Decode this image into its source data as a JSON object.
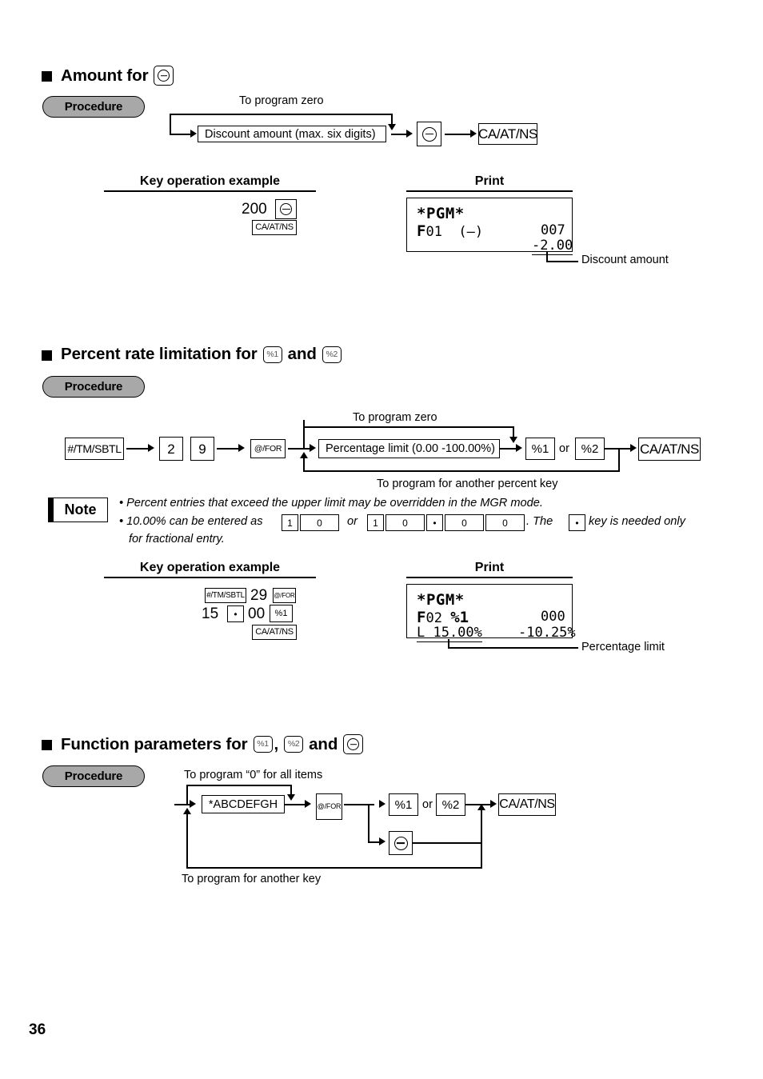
{
  "page": {
    "number": "36"
  },
  "sections": [
    {
      "id": "amount-for-minus",
      "title_prefix": "Amount for",
      "title_keys": [
        "minus"
      ],
      "procedure_label": "Procedure",
      "flow": {
        "top_label": "To program zero",
        "box_label": "Discount amount (max. six digits)",
        "keys": [
          "minus",
          "CA/AT/NS"
        ]
      },
      "columns": {
        "left": "Key operation example",
        "right": "Print"
      },
      "key_operation": {
        "line1_value": "200",
        "line1_key": "minus",
        "line2_key": "CA/AT/NS"
      },
      "print": {
        "header": "*PGM*",
        "row1_left_bold": "F",
        "row1_left_rest": "01",
        "row1_mid": "(—)",
        "row1_right": "007",
        "row2_right": "-2.00",
        "callout": "Discount amount"
      }
    },
    {
      "id": "percent-rate-limitation",
      "title_prefix": "Percent rate limitation for",
      "title_mid": "and",
      "title_keys": [
        "%1",
        "%2"
      ],
      "procedure_label": "Procedure",
      "flow": {
        "top_label": "To program zero",
        "bottom_label": "To program for another percent key",
        "box_label": "Percentage limit (0.00 -100.00%)",
        "key_sbtl": "#/TM/SBTL",
        "key_digit1": "2",
        "key_digit2": "9",
        "key_for": "@/FOR",
        "key_pct1": "%1",
        "or_label": "or",
        "key_pct2": "%2",
        "key_ca": "CA/AT/NS"
      },
      "note": {
        "label": "Note",
        "bullet1": "• Percent entries that exceed the upper limit may be overridden in the MGR mode.",
        "bullet2_a": "• 10.00% can be entered as",
        "bullet2_keys_a": [
          "1",
          "0"
        ],
        "bullet2_or": "or",
        "bullet2_keys_b": [
          "1",
          "0",
          "•",
          "0",
          "0"
        ],
        "bullet2_b": ". The",
        "bullet2_key_dot": "•",
        "bullet2_c": "key is needed only",
        "bullet3": "for fractional entry."
      },
      "columns": {
        "left": "Key operation example",
        "right": "Print"
      },
      "key_operation": {
        "line1_key1": "#/TM/SBTL",
        "line1_value": "29",
        "line1_key2": "@/FOR",
        "line2_value1": "15",
        "line2_key_dot": "•",
        "line2_value2": "00",
        "line2_key": "%1",
        "line3_key": "CA/AT/NS"
      },
      "print": {
        "header": "*PGM*",
        "row1_left_bold": "F",
        "row1_left_rest": "02",
        "row1_mid": "%1",
        "row1_right": "000",
        "row2_left": "L 15.00%",
        "row2_right": "-10.25%",
        "callout": "Percentage limit"
      }
    },
    {
      "id": "function-parameters",
      "title_prefix": "Function parameters for",
      "title_comma": ",",
      "title_mid": "and",
      "title_keys": [
        "%1",
        "%2",
        "minus"
      ],
      "procedure_label": "Procedure",
      "flow": {
        "top_label": "To program “0” for all items",
        "bottom_label": "To program for another key",
        "box_label": "*ABCDEFGH",
        "key_for": "@/FOR",
        "key_pct1": "%1",
        "or_label": "or",
        "key_pct2": "%2",
        "key_minus": "minus",
        "key_ca": "CA/AT/NS"
      }
    }
  ]
}
